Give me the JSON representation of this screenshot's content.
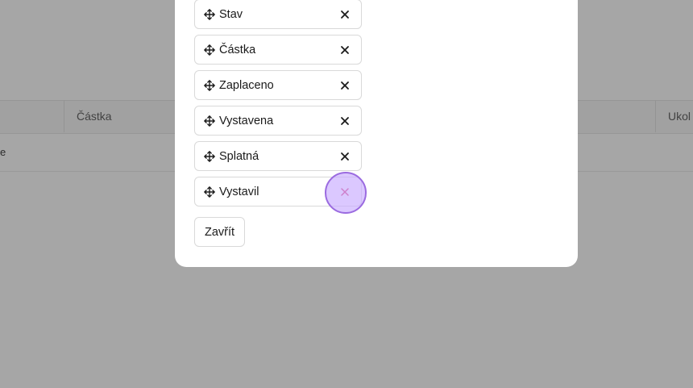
{
  "background": {
    "table_headers": [
      "Částka",
      "Ukol"
    ],
    "first_row_cell": "e"
  },
  "modal": {
    "columns": [
      {
        "label": "Stav",
        "icon": "drag-handle-icon",
        "remove_icon": "close-icon"
      },
      {
        "label": "Částka",
        "icon": "drag-handle-icon",
        "remove_icon": "close-icon"
      },
      {
        "label": "Zaplaceno",
        "icon": "drag-handle-icon",
        "remove_icon": "close-icon"
      },
      {
        "label": "Vystavena",
        "icon": "drag-handle-icon",
        "remove_icon": "close-icon"
      },
      {
        "label": "Splatná",
        "icon": "drag-handle-icon",
        "remove_icon": "close-icon"
      },
      {
        "label": "Vystavil",
        "icon": "drag-handle-icon",
        "remove_icon": "close-icon"
      }
    ],
    "close_label": "Zavřít"
  },
  "colors": {
    "overlay": "rgba(0,0,0,0.35)",
    "highlight_ring": "#9b6be0",
    "highlight_fill": "#c8aaff",
    "remove_hover": "#d6336c"
  }
}
